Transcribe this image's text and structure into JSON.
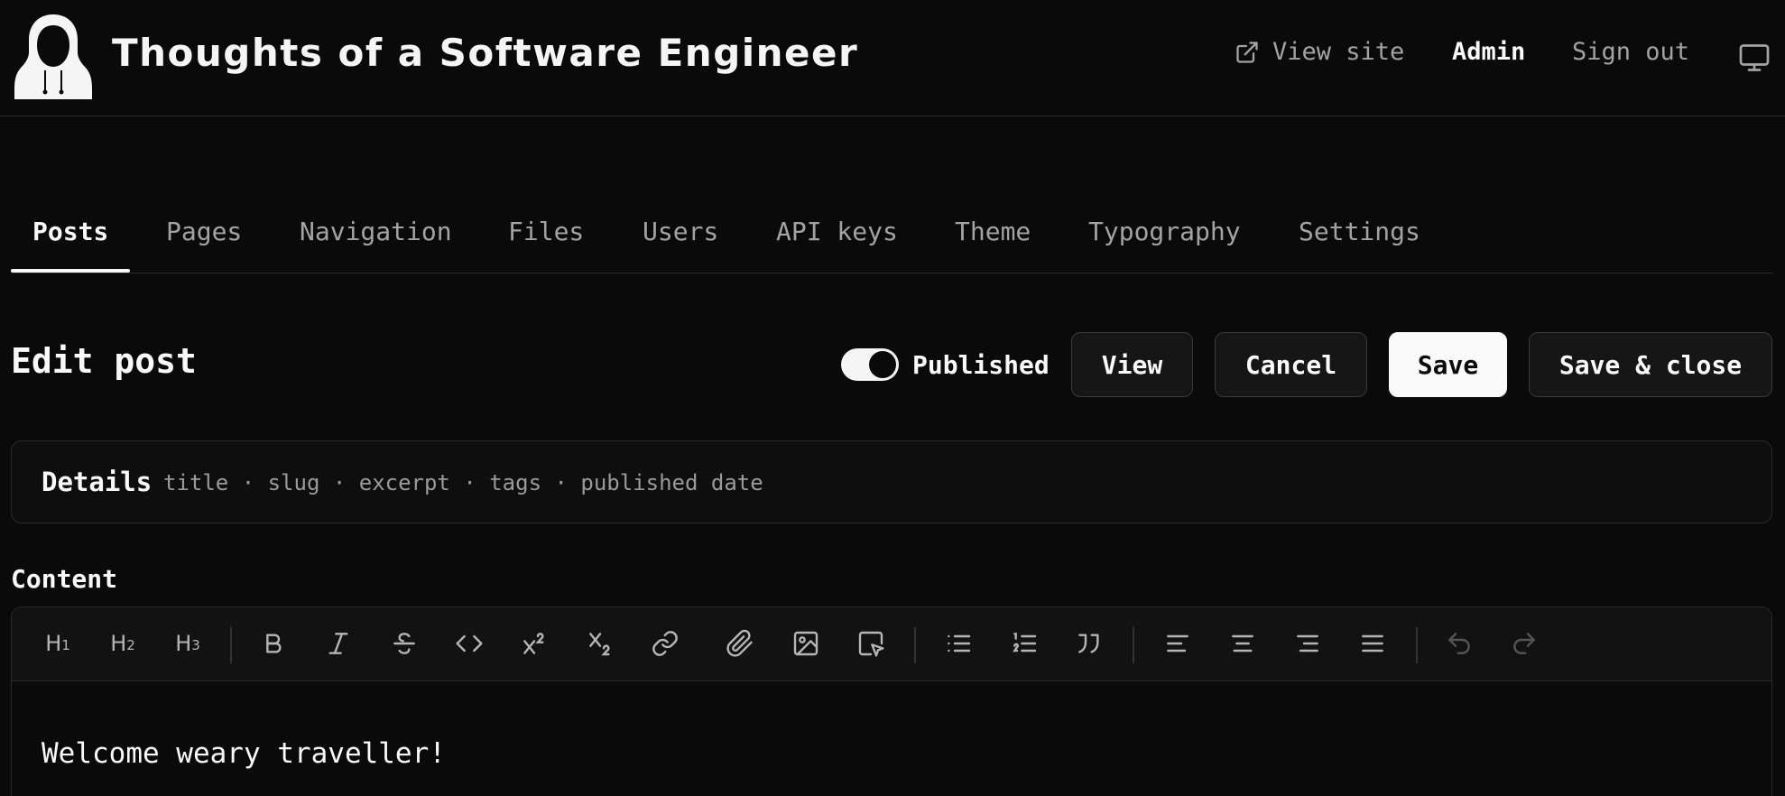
{
  "header": {
    "site_title": "Thoughts of a Software Engineer",
    "nav": {
      "view_site": "View site",
      "admin": "Admin",
      "sign_out": "Sign out"
    }
  },
  "tabs": [
    {
      "label": "Posts",
      "active": true
    },
    {
      "label": "Pages"
    },
    {
      "label": "Navigation"
    },
    {
      "label": "Files"
    },
    {
      "label": "Users"
    },
    {
      "label": "API keys"
    },
    {
      "label": "Theme"
    },
    {
      "label": "Typography"
    },
    {
      "label": "Settings"
    }
  ],
  "edit_bar": {
    "title": "Edit post",
    "published_label": "Published",
    "published": true,
    "view": "View",
    "cancel": "Cancel",
    "save": "Save",
    "save_close": "Save & close"
  },
  "details": {
    "title": "Details",
    "summary": "title · slug · excerpt · tags · published date"
  },
  "content": {
    "label": "Content",
    "toolbar": {
      "h1": "H",
      "h1_sub": "1",
      "h2": "H",
      "h2_sub": "2",
      "h3": "H",
      "h3_sub": "3",
      "icons": [
        "bold-icon",
        "italic-icon",
        "strikethrough-icon",
        "code-icon",
        "superscript-icon",
        "subscript-icon",
        "link-icon",
        "attachment-icon",
        "image-icon",
        "select-icon",
        "bullet-list-icon",
        "numbered-list-icon",
        "quote-icon",
        "align-left-icon",
        "align-center-icon",
        "align-right-icon",
        "justify-icon",
        "undo-icon",
        "redo-icon"
      ]
    },
    "body_text": "Welcome weary traveller!"
  },
  "colors": {
    "background": "#0a0a0a",
    "text": "#fafafa",
    "muted": "#a3a3a3",
    "border": "#2a2a2a"
  }
}
